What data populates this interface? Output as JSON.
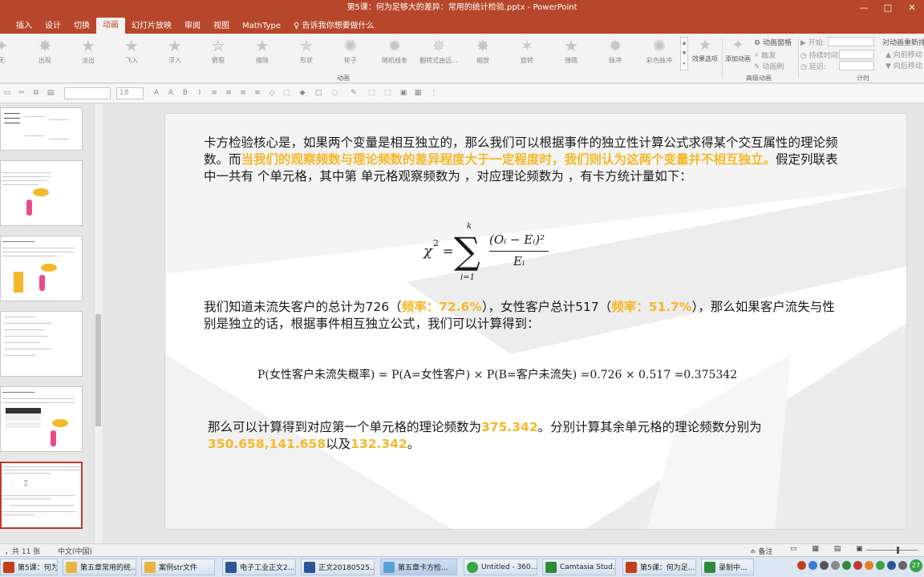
{
  "window": {
    "title": "第5课：何为足够大的差异：常用的统计检验.pptx - PowerPoint",
    "controls": [
      "—",
      "□",
      "✕"
    ]
  },
  "tabs": [
    "插入",
    "设计",
    "切换",
    "动画",
    "幻灯片放映",
    "审阅",
    "视图",
    "MathType"
  ],
  "tell_me": "告诉我你想要做什么",
  "animations": [
    "无",
    "出现",
    "淡出",
    "飞入",
    "浮入",
    "劈裂",
    "擦除",
    "形状",
    "轮子",
    "随机线条",
    "翻转式由远...",
    "缩放",
    "旋转",
    "弹跳",
    "脉冲",
    "彩色脉冲"
  ],
  "ribbon": {
    "effect_options": "效果选项",
    "add_animation": "添加动画",
    "animation_pane": "动画窗格",
    "trigger": "触发",
    "animation_painter": "动画刷",
    "start_label": "开始:",
    "duration_label": "持续时间:",
    "delay_label": "延迟:",
    "reorder_title": "对动画重新排序",
    "move_earlier": "向前移动",
    "move_later": "向后移动",
    "group_animation": "动画",
    "group_advanced": "高级动画",
    "group_timing": "计时"
  },
  "formatbar": {
    "font_size": "18"
  },
  "slide": {
    "para1_normal": "卡方检验核心是，如果两个变量是相互独立的，那么我们可以根据事件的独立性计算公式求得某个交互属性的理论频数。而",
    "para1_highlight": "当我们的观察频数与理论频数的差异程度大于一定程度时，我们则认为这两个变量并不相互独立。",
    "para1_end": "假定列联表中一共有 个单元格，其中第 单元格观察频数为 ，对应理论频数为 ，有卡方统计量如下：",
    "formula": {
      "chi": "χ",
      "sq": "2",
      "eq": "=",
      "sigma": "∑",
      "upper": "k",
      "lower": "i=1",
      "numerator": "(Oᵢ − Eᵢ)²",
      "denominator": "Eᵢ"
    },
    "para2_a": "我们知道未流失客户的总计为726（",
    "para2_rate1": "频率：72.6%",
    "para2_b": "），女性客户总计517（",
    "para2_rate2": "频率：51.7%",
    "para2_c": "），那么如果客户流失与性别是独立的话，根据事件相互独立公式，我们可以计算得到：",
    "prob_formula": "P(女性客户未流失概率) = P(A=女性客户) × P(B=客户未流失) =0.726 × 0.517 =0.375342",
    "para3_a": "那么可以计算得到对应第一个单元格的理论频数为",
    "para3_v1": "375.342",
    "para3_b": "。分别计算其余单元格的理论频数分别为",
    "para3_v2": "350.658",
    "para3_sep1": ",",
    "para3_v3": "141.658",
    "para3_sep2": "以及",
    "para3_v4": "132.342",
    "para3_end": "。"
  },
  "status": {
    "slide_count": "，共 11 张",
    "language": "中文(中国)",
    "notes": "备注",
    "zoom_icons": "▭ ▦ ▤ ▣"
  },
  "taskbar": [
    {
      "label": "第5课：何为足...",
      "color": "#c43e1c"
    },
    {
      "label": "第五章常用的统...",
      "color": "#e8b540"
    },
    {
      "label": "案例str文件",
      "color": "#e8b540"
    },
    {
      "label": "电子工业正文2...",
      "color": "#2b579a"
    },
    {
      "label": "正文20180525...",
      "color": "#2b579a"
    },
    {
      "label": "第五章卡方检...",
      "color": "#5aa0d8"
    },
    {
      "label": "Untitled - 360...",
      "color": "#3aa447"
    },
    {
      "label": "Camtasia Stud...",
      "color": "#2e8b3a"
    },
    {
      "label": "第5课：何为足...",
      "color": "#c43e1c"
    },
    {
      "label": "录制中...",
      "color": "#2e8b3a"
    }
  ],
  "tray": {
    "badge": "27"
  }
}
